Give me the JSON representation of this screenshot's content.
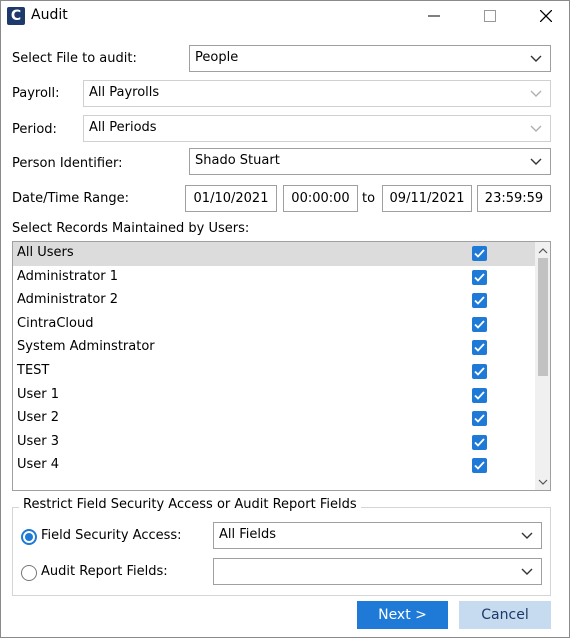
{
  "window": {
    "title": "Audit",
    "logo_letter": "C"
  },
  "form": {
    "select_file_label": "Select File to audit:",
    "select_file_value": "People",
    "payroll_label": "Payroll:",
    "payroll_value": "All Payrolls",
    "period_label": "Period:",
    "period_value": "All Periods",
    "person_label": "Person Identifier:",
    "person_value": "Shado Stuart",
    "daterange_label": "Date/Time Range:",
    "date_from": "01/10/2021",
    "time_from": "00:00:00",
    "to_label": "to",
    "date_to": "09/11/2021",
    "time_to": "23:59:59",
    "records_label": "Select Records Maintained by Users:"
  },
  "users": [
    {
      "label": "All Users",
      "checked": true
    },
    {
      "label": "Administrator 1",
      "checked": true
    },
    {
      "label": "Administrator 2",
      "checked": true
    },
    {
      "label": "CintraCloud",
      "checked": true
    },
    {
      "label": "System Adminstrator",
      "checked": true
    },
    {
      "label": "TEST",
      "checked": true
    },
    {
      "label": "User 1",
      "checked": true
    },
    {
      "label": "User 2",
      "checked": true
    },
    {
      "label": "User 3",
      "checked": true
    },
    {
      "label": "User 4",
      "checked": true
    }
  ],
  "restrict": {
    "group_title": "Restrict Field Security Access or Audit Report Fields",
    "field_security_label": "Field Security Access:",
    "field_security_value": "All Fields",
    "audit_report_label": "Audit Report Fields:",
    "audit_report_value": ""
  },
  "buttons": {
    "next": "Next >",
    "cancel": "Cancel"
  },
  "colors": {
    "accent": "#1e7ad6",
    "cancel_bg": "#c6daf0",
    "logo_bg": "#1e3a6d"
  }
}
